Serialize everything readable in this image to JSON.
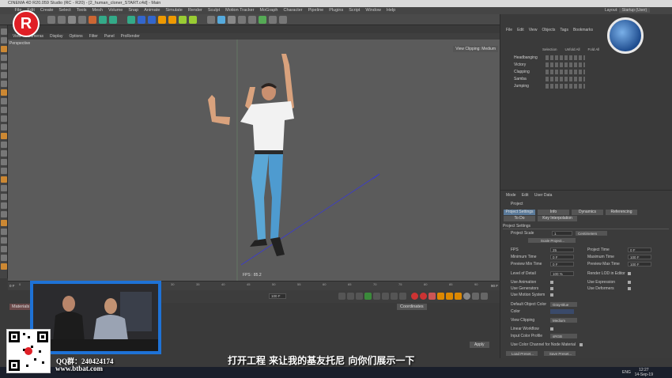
{
  "window": {
    "title": "CINEMA 4D R20.059 Studio (RC - R20) - [2_human_cloner_START.c4d] - Main"
  },
  "menubar": [
    "File",
    "Edit",
    "Create",
    "Select",
    "Tools",
    "Mesh",
    "Volume",
    "Snap",
    "Animate",
    "Simulate",
    "Render",
    "Sculpt",
    "Motion Tracker",
    "MoGraph",
    "Character",
    "Pipeline",
    "Plugins",
    "Script",
    "Window",
    "Help"
  ],
  "layout": {
    "label": "Layout:",
    "value": "Startup (User)"
  },
  "viewport": {
    "menu": [
      "View",
      "Cameras",
      "Display",
      "Options",
      "Filter",
      "Panel",
      "ProRender"
    ],
    "label": "Perspective",
    "clipping": "View Clipping: Medium",
    "fps": "FPS : 85.2"
  },
  "timeline": {
    "ticks": [
      "0",
      "5",
      "10",
      "15",
      "20",
      "25",
      "30",
      "35",
      "40",
      "45",
      "50",
      "55",
      "60",
      "65",
      "70",
      "75",
      "80",
      "85",
      "90"
    ],
    "start": "0 F",
    "end": "90 F",
    "current": "100 F"
  },
  "panels": {
    "coordinates": "Coordinates",
    "material": "Materials",
    "apply": "Apply"
  },
  "object_manager": {
    "menu": [
      "File",
      "Edit",
      "View",
      "Objects",
      "Tags",
      "Bookmarks"
    ],
    "columns": [
      "Selection",
      "Unfold All",
      "Fold All"
    ],
    "objects": [
      {
        "name": "Headbanging"
      },
      {
        "name": "Victory"
      },
      {
        "name": "Clapping"
      },
      {
        "name": "Samba"
      },
      {
        "name": "Jumping"
      }
    ]
  },
  "attributes": {
    "menu": [
      "Mode",
      "Edit",
      "User Data"
    ],
    "section": "Project",
    "tabs": [
      "Project Settings",
      "Info",
      "Dynamics",
      "Referencing",
      "To Do",
      "Key Interpolation"
    ],
    "header": "Project Settings",
    "project_scale": {
      "label": "Project Scale",
      "value": "1",
      "unit": "Centimeters"
    },
    "scale_button": "Scale Project...",
    "fields": [
      {
        "label": "FPS",
        "value": "25"
      },
      {
        "label": "Project Time",
        "value": "0 F"
      },
      {
        "label": "Minimum Time",
        "value": "0 F"
      },
      {
        "label": "Maximum Time",
        "value": "100 F"
      },
      {
        "label": "Preview Min Time",
        "value": "0 F"
      },
      {
        "label": "Preview Max Time",
        "value": "100 F"
      },
      {
        "label": "Level of Detail",
        "value": "100 %"
      },
      {
        "label": "Render LOD in Editor",
        "value": ""
      }
    ],
    "checks": [
      "Use Animation",
      "Use Expression",
      "Use Generators",
      "Use Deformers",
      "Use Motion System"
    ],
    "default_color": {
      "label": "Default Object Color",
      "value": "Gray-Blue"
    },
    "color_label": "Color",
    "view_clipping": {
      "label": "View Clipping",
      "value": "Medium"
    },
    "linear_workflow": "Linear Workflow",
    "input_color_profile": {
      "label": "Input Color Profile",
      "value": "sRGB"
    },
    "color_channel": "Use Color Channel for Node Material",
    "buttons": [
      "Load Preset...",
      "Save Preset..."
    ]
  },
  "overlay": {
    "qq": "QQ群：240424174",
    "site": "www.btbat.com",
    "subtitle": "打开工程 来让我的基友托尼 向你们展示一下",
    "logo_letter": "R"
  },
  "taskbar": {
    "time": "12:27",
    "date": "14-Sep-19",
    "lang": "ENG"
  },
  "colors": {
    "accent_blue": "#1e72d6",
    "logo_red": "#e01f26",
    "ui_dark": "#3a3a3a"
  }
}
